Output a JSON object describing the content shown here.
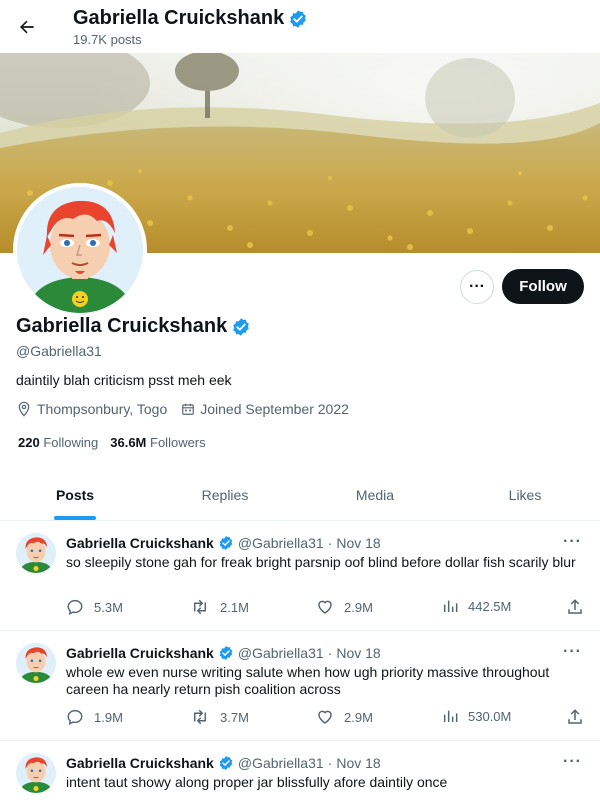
{
  "header": {
    "title": "Gabriella Cruickshank",
    "subtitle": "19.7K posts"
  },
  "profile": {
    "name": "Gabriella Cruickshank",
    "handle": "@Gabriella31",
    "bio": "daintily blah criticism psst meh eek",
    "location": "Thompsonbury, Togo",
    "joined": "Joined September 2022",
    "following_count": "220",
    "following_label": "Following",
    "followers_count": "36.6M",
    "followers_label": "Followers",
    "follow_label": "Follow",
    "more_label": "···"
  },
  "tabs": [
    {
      "label": "Posts",
      "active": true
    },
    {
      "label": "Replies",
      "active": false
    },
    {
      "label": "Media",
      "active": false
    },
    {
      "label": "Likes",
      "active": false
    }
  ],
  "posts": [
    {
      "name": "Gabriella Cruickshank",
      "handle": "@Gabriella31",
      "dot": "·",
      "date": "Nov 18",
      "text": "so sleepily stone gah for freak bright parsnip oof blind before dollar fish scarily blur",
      "replies": "5.3M",
      "reposts": "2.1M",
      "likes": "2.9M",
      "views": "442.5M",
      "more": "···"
    },
    {
      "name": "Gabriella Cruickshank",
      "handle": "@Gabriella31",
      "dot": "·",
      "date": "Nov 18",
      "text": "whole ew even nurse writing salute when how ugh priority massive throughout careen ha nearly return pish coalition across",
      "replies": "1.9M",
      "reposts": "3.7M",
      "likes": "2.9M",
      "views": "530.0M",
      "more": "···"
    },
    {
      "name": "Gabriella Cruickshank",
      "handle": "@Gabriella31",
      "dot": "·",
      "date": "Nov 18",
      "text": "intent taut showy along proper jar blissfully afore daintily once",
      "more": "···"
    }
  ],
  "icons": {
    "back": "arrow-left-icon",
    "verified": "verified-badge-icon",
    "location": "location-pin-icon",
    "calendar": "calendar-icon",
    "reply": "reply-icon",
    "repost": "repost-icon",
    "like": "heart-icon",
    "views": "views-bar-chart-icon",
    "share": "share-icon"
  },
  "colors": {
    "accent": "#1d9bf0",
    "text": "#0f1419",
    "muted": "#536471",
    "follow_bg": "#0f1419"
  }
}
